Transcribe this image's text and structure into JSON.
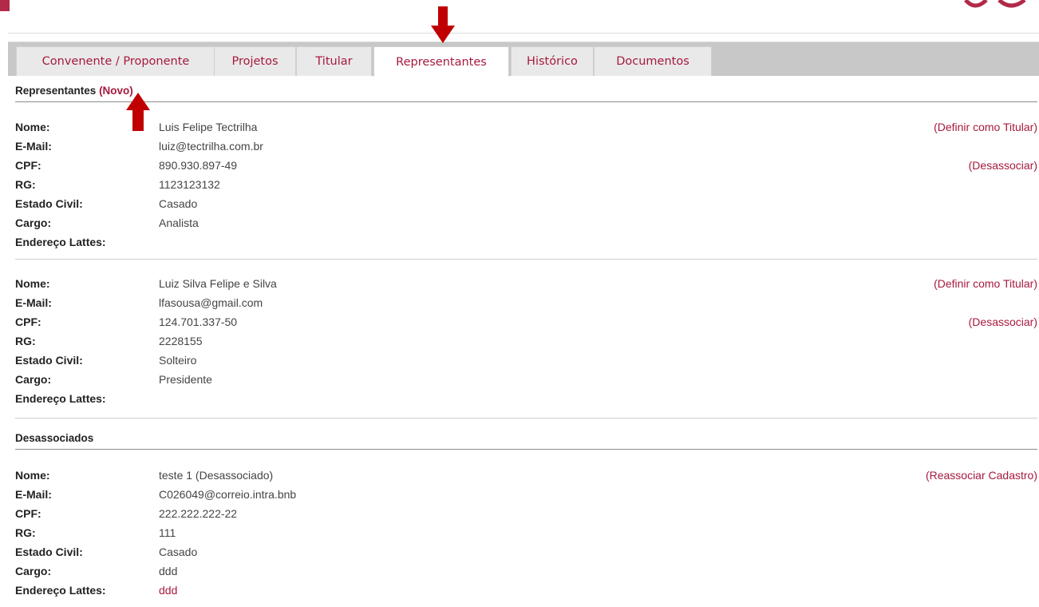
{
  "tabs": [
    {
      "label": "Convenente / Proponente"
    },
    {
      "label": "Projetos"
    },
    {
      "label": "Titular"
    },
    {
      "label": "Representantes"
    },
    {
      "label": "Histórico"
    },
    {
      "label": "Documentos"
    }
  ],
  "active_tab": "Representantes",
  "representantes": {
    "header": "Representantes",
    "novo_label": "(Novo)",
    "records": [
      {
        "nome_label": "Nome:",
        "nome": "Luis Felipe Tectrilha",
        "email_label": "E-Mail:",
        "email": "luiz@tectrilha.com.br",
        "cpf_label": "CPF:",
        "cpf": "890.930.897-49",
        "rg_label": "RG:",
        "rg": "1123123132",
        "estado_civil_label": "Estado Civil:",
        "estado_civil": "Casado",
        "cargo_label": "Cargo:",
        "cargo": "Analista",
        "lattes_label": "Endereço Lattes:",
        "lattes": "",
        "action_primary": "(Definir como Titular)",
        "action_secondary": "(Desassociar)"
      },
      {
        "nome_label": "Nome:",
        "nome": "Luiz Silva Felipe e Silva",
        "email_label": "E-Mail:",
        "email": "lfasousa@gmail.com",
        "cpf_label": "CPF:",
        "cpf": "124.701.337-50",
        "rg_label": "RG:",
        "rg": "2228155",
        "estado_civil_label": "Estado Civil:",
        "estado_civil": "Solteiro",
        "cargo_label": "Cargo:",
        "cargo": "Presidente",
        "lattes_label": "Endereço Lattes:",
        "lattes": "",
        "action_primary": "(Definir como Titular)",
        "action_secondary": "(Desassociar)"
      }
    ]
  },
  "desassociados": {
    "header": "Desassociados",
    "records": [
      {
        "nome_label": "Nome:",
        "nome": "teste 1 (Desassociado)",
        "email_label": "E-Mail:",
        "email": "C026049@correio.intra.bnb",
        "cpf_label": "CPF:",
        "cpf": "222.222.222-22",
        "rg_label": "RG:",
        "rg": "111",
        "estado_civil_label": "Estado Civil:",
        "estado_civil": "Casado",
        "cargo_label": "Cargo:",
        "cargo": "ddd",
        "lattes_label": "Endereço Lattes:",
        "lattes": "ddd",
        "action_primary": "(Reassociar Cadastro)"
      }
    ]
  },
  "colors": {
    "accent": "#a61a3d",
    "annotation_arrow": "#c00000",
    "tabbar": "#c8c8c8"
  }
}
